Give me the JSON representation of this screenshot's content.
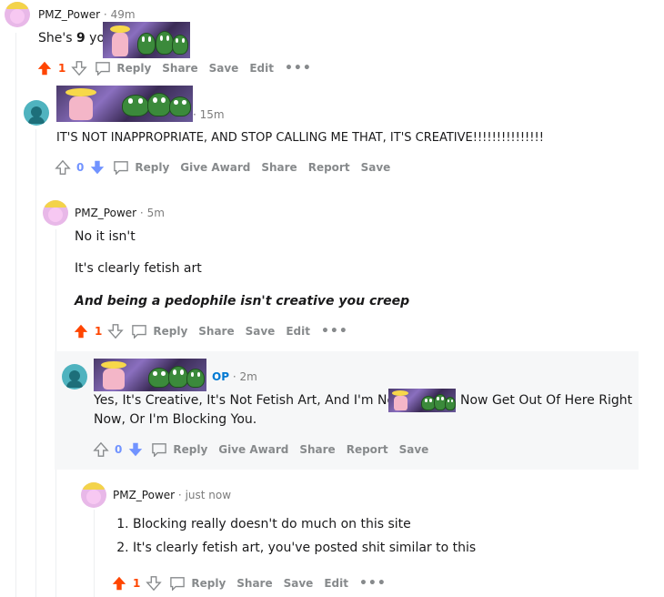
{
  "colors": {
    "upvote": "#ff4500",
    "downvote": "#7193ff",
    "op": "#0079d3",
    "meta": "#7c7c7c",
    "action": "#878a8c"
  },
  "comments": [
    {
      "user": "PMZ_Power",
      "time": "49m",
      "text_prefix": "She's ",
      "text_bold": "9",
      "text_suffix": " you",
      "score": "1",
      "vote_state": "up",
      "actions": [
        "Reply",
        "Share",
        "Save",
        "Edit"
      ]
    },
    {
      "time": "15m",
      "text": "IT'S NOT INAPPROPRIATE, AND STOP CALLING ME THAT, IT'S CREATIVE!!!!!!!!!!!!!!!",
      "score": "0",
      "vote_state": "down",
      "actions": [
        "Reply",
        "Give Award",
        "Share",
        "Report",
        "Save"
      ]
    },
    {
      "user": "PMZ_Power",
      "time": "5m",
      "paragraphs": [
        "No it isn't",
        "It's clearly fetish art"
      ],
      "bold_italic": "And being a pedophile isn't creative you creep",
      "score": "1",
      "vote_state": "up",
      "actions": [
        "Reply",
        "Share",
        "Save",
        "Edit"
      ]
    },
    {
      "op_label": "OP",
      "time": "2m",
      "text_part1": "Yes, It's Creative, It's Not Fetish Art, And I'm Not A",
      "text_part2": "Now Get Out Of Here Right",
      "text_line2": "Now, Or I'm Blocking You.",
      "score": "0",
      "vote_state": "down",
      "actions": [
        "Reply",
        "Give Award",
        "Share",
        "Report",
        "Save"
      ]
    },
    {
      "user": "PMZ_Power",
      "time": "just now",
      "list_items": [
        "Blocking really doesn't do much on this site",
        "It's clearly fetish art, you've posted shit similar to this"
      ],
      "score": "1",
      "vote_state": "up",
      "actions": [
        "Reply",
        "Share",
        "Save",
        "Edit"
      ]
    }
  ],
  "icons": [
    "upvote-arrow-icon",
    "downvote-arrow-icon",
    "comment-bubble-icon",
    "more-options-icon",
    "redacted-username-emote"
  ]
}
